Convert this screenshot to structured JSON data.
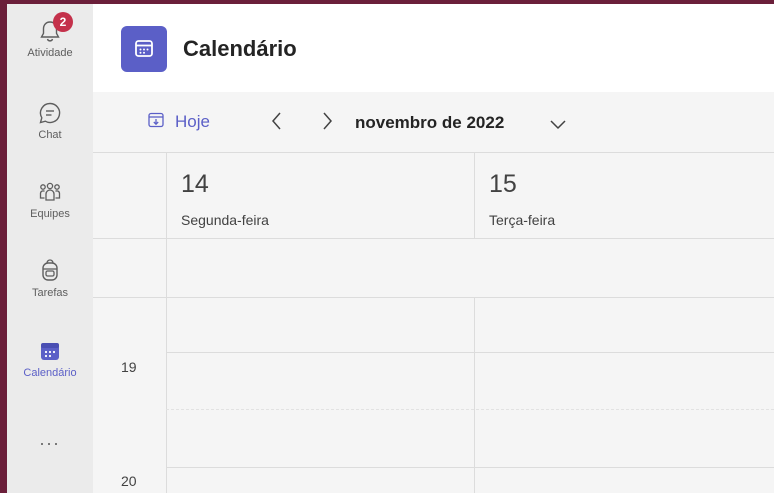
{
  "rail": {
    "activity": {
      "label": "Atividade",
      "badge": "2"
    },
    "chat": {
      "label": "Chat"
    },
    "teams": {
      "label": "Equipes"
    },
    "tasks": {
      "label": "Tarefas"
    },
    "calendar": {
      "label": "Calendário"
    },
    "more": "..."
  },
  "header": {
    "title": "Calendário"
  },
  "toolbar": {
    "today_label": "Hoje",
    "month_label": "novembro de 2022"
  },
  "days": [
    {
      "number": "14",
      "name": "Segunda-feira"
    },
    {
      "number": "15",
      "name": "Terça-feira"
    }
  ],
  "hours": [
    "19",
    "20"
  ],
  "colors": {
    "accent": "#5b5fc7",
    "badge": "#c4314b",
    "frame": "#6b1f3a"
  }
}
